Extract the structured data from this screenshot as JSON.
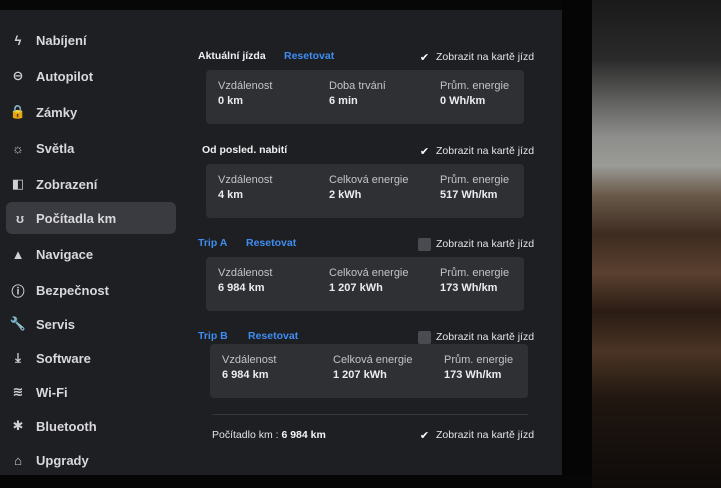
{
  "sidebar": {
    "items": [
      {
        "label": "Nabíjení",
        "icon": "bolt-icon",
        "glyph": "ϟ"
      },
      {
        "label": "Autopilot",
        "icon": "steering-wheel-icon",
        "glyph": "⊖"
      },
      {
        "label": "Zámky",
        "icon": "lock-icon",
        "glyph": "🔒"
      },
      {
        "label": "Světla",
        "icon": "light-icon",
        "glyph": "☼"
      },
      {
        "label": "Zobrazení",
        "icon": "display-icon",
        "glyph": "◧"
      },
      {
        "label": "Počítadla km",
        "icon": "trip-counter-icon",
        "glyph": "ʊ"
      },
      {
        "label": "Navigace",
        "icon": "navigation-icon",
        "glyph": "▲"
      },
      {
        "label": "Bezpečnost",
        "icon": "safety-icon",
        "glyph": "ⓘ"
      },
      {
        "label": "Servis",
        "icon": "wrench-icon",
        "glyph": "🔧"
      },
      {
        "label": "Software",
        "icon": "download-icon",
        "glyph": "⤓"
      },
      {
        "label": "Wi-Fi",
        "icon": "wifi-icon",
        "glyph": "≋"
      },
      {
        "label": "Bluetooth",
        "icon": "bluetooth-icon",
        "glyph": "✱"
      },
      {
        "label": "Upgrady",
        "icon": "shopping-bag-icon",
        "glyph": "⌂"
      }
    ],
    "active_item": "Počítadla km"
  },
  "check_glyph": "✔",
  "sections": {
    "current": {
      "title": "Aktuální jízda",
      "reset": "Resetovat",
      "show_label": "Zobrazit na kartě jízd",
      "show_checked": true,
      "stats": [
        {
          "label": "Vzdálenost",
          "value": "0 km"
        },
        {
          "label": "Doba trvání",
          "value": "6 min"
        },
        {
          "label": "Prům. energie",
          "value": "0 Wh/km"
        }
      ]
    },
    "since_charge": {
      "title": "Od posled. nabití",
      "show_label": "Zobrazit na kartě jízd",
      "show_checked": true,
      "stats": [
        {
          "label": "Vzdálenost",
          "value": "4 km"
        },
        {
          "label": "Celková energie",
          "value": "2 kWh"
        },
        {
          "label": "Prům. energie",
          "value": "517 Wh/km"
        }
      ]
    },
    "trip_a": {
      "title": "Trip A",
      "reset": "Resetovat",
      "show_label": "Zobrazit na kartě jízd",
      "show_checked": false,
      "stats": [
        {
          "label": "Vzdálenost",
          "value": "6 984 km"
        },
        {
          "label": "Celková energie",
          "value": "1 207 kWh"
        },
        {
          "label": "Prům. energie",
          "value": "173 Wh/km"
        }
      ]
    },
    "trip_b": {
      "title": "Trip B",
      "reset": "Resetovat",
      "show_label": "Zobrazit na kartě jízd",
      "show_checked": false,
      "stats": [
        {
          "label": "Vzdálenost",
          "value": "6 984 km"
        },
        {
          "label": "Celková energie",
          "value": "1 207 kWh"
        },
        {
          "label": "Prům. energie",
          "value": "173 Wh/km"
        }
      ]
    }
  },
  "odometer": {
    "label": "Počítadlo km :",
    "value": "6 984 km",
    "show_label": "Zobrazit na kartě jízd",
    "show_checked": true
  },
  "colors": {
    "accent": "#3e8df2",
    "screen_bg": "#1e1f22",
    "panel_bg": "#2f3034"
  }
}
